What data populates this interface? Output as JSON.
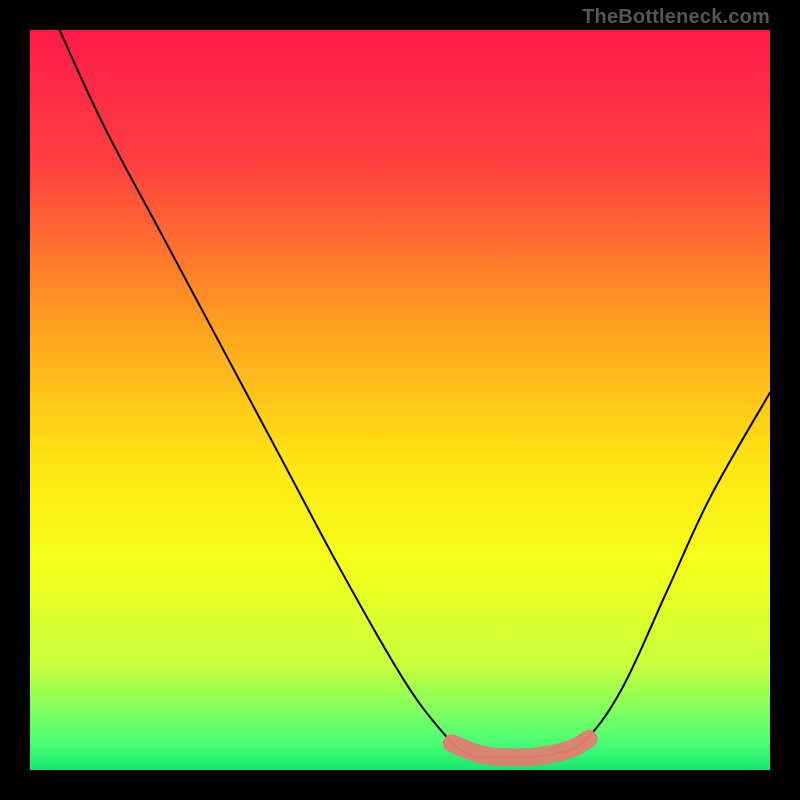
{
  "watermark": "TheBottleneck.com",
  "chart_data": {
    "type": "line",
    "title": "",
    "xlabel": "",
    "ylabel": "",
    "xlim": [
      0,
      100
    ],
    "ylim": [
      0,
      100
    ],
    "gradient_stops": [
      {
        "offset": 0,
        "color": "#ff1a4b"
      },
      {
        "offset": 18,
        "color": "#ff3f3f"
      },
      {
        "offset": 40,
        "color": "#ffa01f"
      },
      {
        "offset": 58,
        "color": "#ffe413"
      },
      {
        "offset": 72,
        "color": "#f5ff1a"
      },
      {
        "offset": 86,
        "color": "#c7ff3e"
      },
      {
        "offset": 96,
        "color": "#4dff74"
      },
      {
        "offset": 100,
        "color": "#17e871"
      }
    ],
    "series": [
      {
        "name": "bottleneck-curve",
        "color": "#000000",
        "width": 2,
        "points": [
          {
            "x": 4,
            "y": 100
          },
          {
            "x": 10,
            "y": 87
          },
          {
            "x": 18,
            "y": 72
          },
          {
            "x": 26,
            "y": 57
          },
          {
            "x": 34,
            "y": 42
          },
          {
            "x": 42,
            "y": 27
          },
          {
            "x": 50,
            "y": 13
          },
          {
            "x": 55,
            "y": 6
          },
          {
            "x": 59,
            "y": 2.2
          },
          {
            "x": 63,
            "y": 1.8
          },
          {
            "x": 67,
            "y": 1.8
          },
          {
            "x": 71,
            "y": 2.2
          },
          {
            "x": 75,
            "y": 4
          },
          {
            "x": 80,
            "y": 11
          },
          {
            "x": 86,
            "y": 24
          },
          {
            "x": 92,
            "y": 37
          },
          {
            "x": 100,
            "y": 51
          }
        ]
      },
      {
        "name": "highlight-band",
        "color": "#e17f73",
        "width": 18,
        "linecap": "round",
        "points": [
          {
            "x": 57,
            "y": 3.6
          },
          {
            "x": 61,
            "y": 2.1
          },
          {
            "x": 65,
            "y": 1.7
          },
          {
            "x": 69,
            "y": 1.9
          },
          {
            "x": 73,
            "y": 2.8
          },
          {
            "x": 75.5,
            "y": 4.2
          }
        ]
      }
    ],
    "baseline": {
      "color": "#17e871",
      "y": 0,
      "thickness": 2
    }
  }
}
